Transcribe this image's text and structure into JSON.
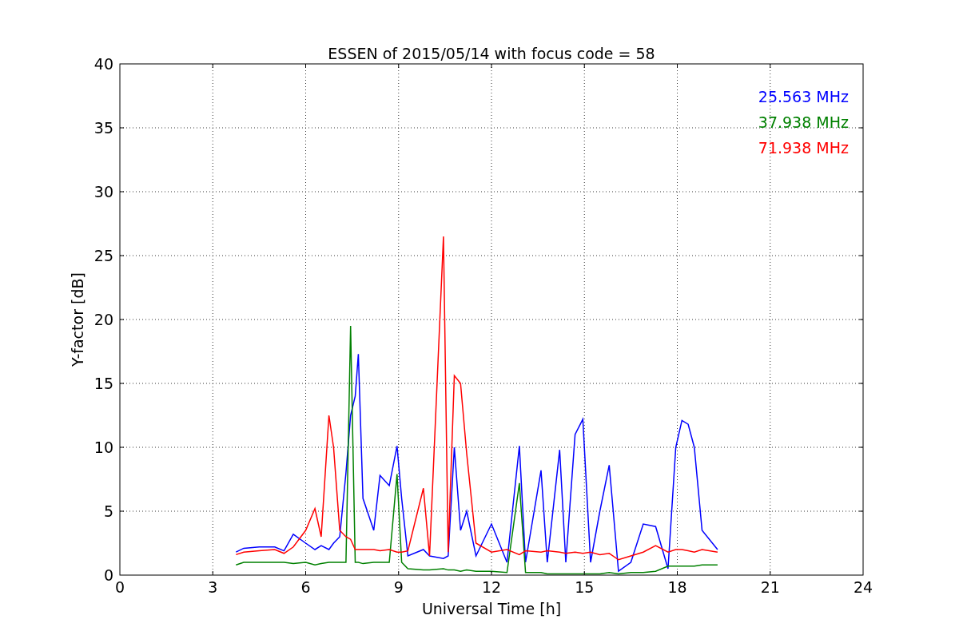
{
  "chart_data": {
    "type": "line",
    "title": "ESSEN of 2015/05/14 with focus code = 58",
    "xlabel": "Universal Time [h]",
    "ylabel": "Y-factor [dB]",
    "xlim": [
      0,
      24
    ],
    "ylim": [
      0,
      40
    ],
    "grid": true,
    "xticks": [
      0,
      3,
      6,
      9,
      12,
      15,
      18,
      21,
      24
    ],
    "yticks": [
      0,
      5,
      10,
      15,
      20,
      25,
      30,
      35,
      40
    ],
    "x": [
      3.75,
      4.0,
      4.5,
      5.0,
      5.3,
      5.6,
      6.0,
      6.3,
      6.5,
      6.75,
      6.9,
      7.1,
      7.3,
      7.45,
      7.6,
      7.7,
      7.85,
      8.2,
      8.4,
      8.7,
      8.95,
      9.1,
      9.3,
      9.8,
      10.0,
      10.45,
      10.6,
      10.8,
      11.0,
      11.2,
      11.5,
      12.0,
      12.5,
      12.9,
      13.1,
      13.6,
      13.8,
      14.2,
      14.4,
      14.7,
      14.95,
      15.2,
      15.5,
      15.8,
      16.1,
      16.5,
      16.9,
      17.3,
      17.7,
      17.95,
      18.15,
      18.35,
      18.55,
      18.8,
      19.3
    ],
    "series": [
      {
        "name": "25.563 MHz",
        "color": "#0000ff",
        "values": [
          1.8,
          2.1,
          2.2,
          2.2,
          1.9,
          3.2,
          2.5,
          2.0,
          2.3,
          2.0,
          2.5,
          3.0,
          8.0,
          12.5,
          14.0,
          17.3,
          6.0,
          3.5,
          7.8,
          7.0,
          10.1,
          6.0,
          1.5,
          2.0,
          1.5,
          1.3,
          1.5,
          10.0,
          3.5,
          5.0,
          1.5,
          4.0,
          1.0,
          10.1,
          1.0,
          8.2,
          1.0,
          9.8,
          1.0,
          11.0,
          12.2,
          1.0,
          5.0,
          8.6,
          0.3,
          1.0,
          4.0,
          3.8,
          0.5,
          10.0,
          12.1,
          11.8,
          10.0,
          3.5,
          2.0
        ]
      },
      {
        "name": "37.938 MHz",
        "color": "#008000",
        "values": [
          0.8,
          1.0,
          1.0,
          1.0,
          1.0,
          0.9,
          1.0,
          0.8,
          0.9,
          1.0,
          1.0,
          1.0,
          1.0,
          19.5,
          1.0,
          1.0,
          0.9,
          1.0,
          1.0,
          1.0,
          7.9,
          1.0,
          0.5,
          0.4,
          0.4,
          0.5,
          0.4,
          0.4,
          0.3,
          0.4,
          0.3,
          0.3,
          0.2,
          7.2,
          0.2,
          0.2,
          0.1,
          0.1,
          0.1,
          0.1,
          0.1,
          0.1,
          0.1,
          0.2,
          0.1,
          0.2,
          0.2,
          0.3,
          0.7,
          0.7,
          0.7,
          0.7,
          0.7,
          0.8,
          0.8
        ]
      },
      {
        "name": "71.938 MHz",
        "color": "#ff0000",
        "values": [
          1.6,
          1.8,
          1.9,
          2.0,
          1.7,
          2.2,
          3.5,
          5.2,
          3.0,
          12.5,
          10.0,
          3.5,
          3.0,
          2.8,
          2.0,
          2.0,
          2.0,
          2.0,
          1.9,
          2.0,
          1.8,
          1.8,
          1.9,
          6.8,
          1.5,
          26.5,
          1.8,
          15.6,
          15.0,
          9.5,
          2.5,
          1.8,
          2.0,
          1.6,
          1.9,
          1.8,
          1.9,
          1.8,
          1.7,
          1.8,
          1.7,
          1.8,
          1.6,
          1.7,
          1.2,
          1.5,
          1.8,
          2.3,
          1.8,
          2.0,
          2.0,
          1.9,
          1.8,
          2.0,
          1.8
        ]
      }
    ]
  }
}
